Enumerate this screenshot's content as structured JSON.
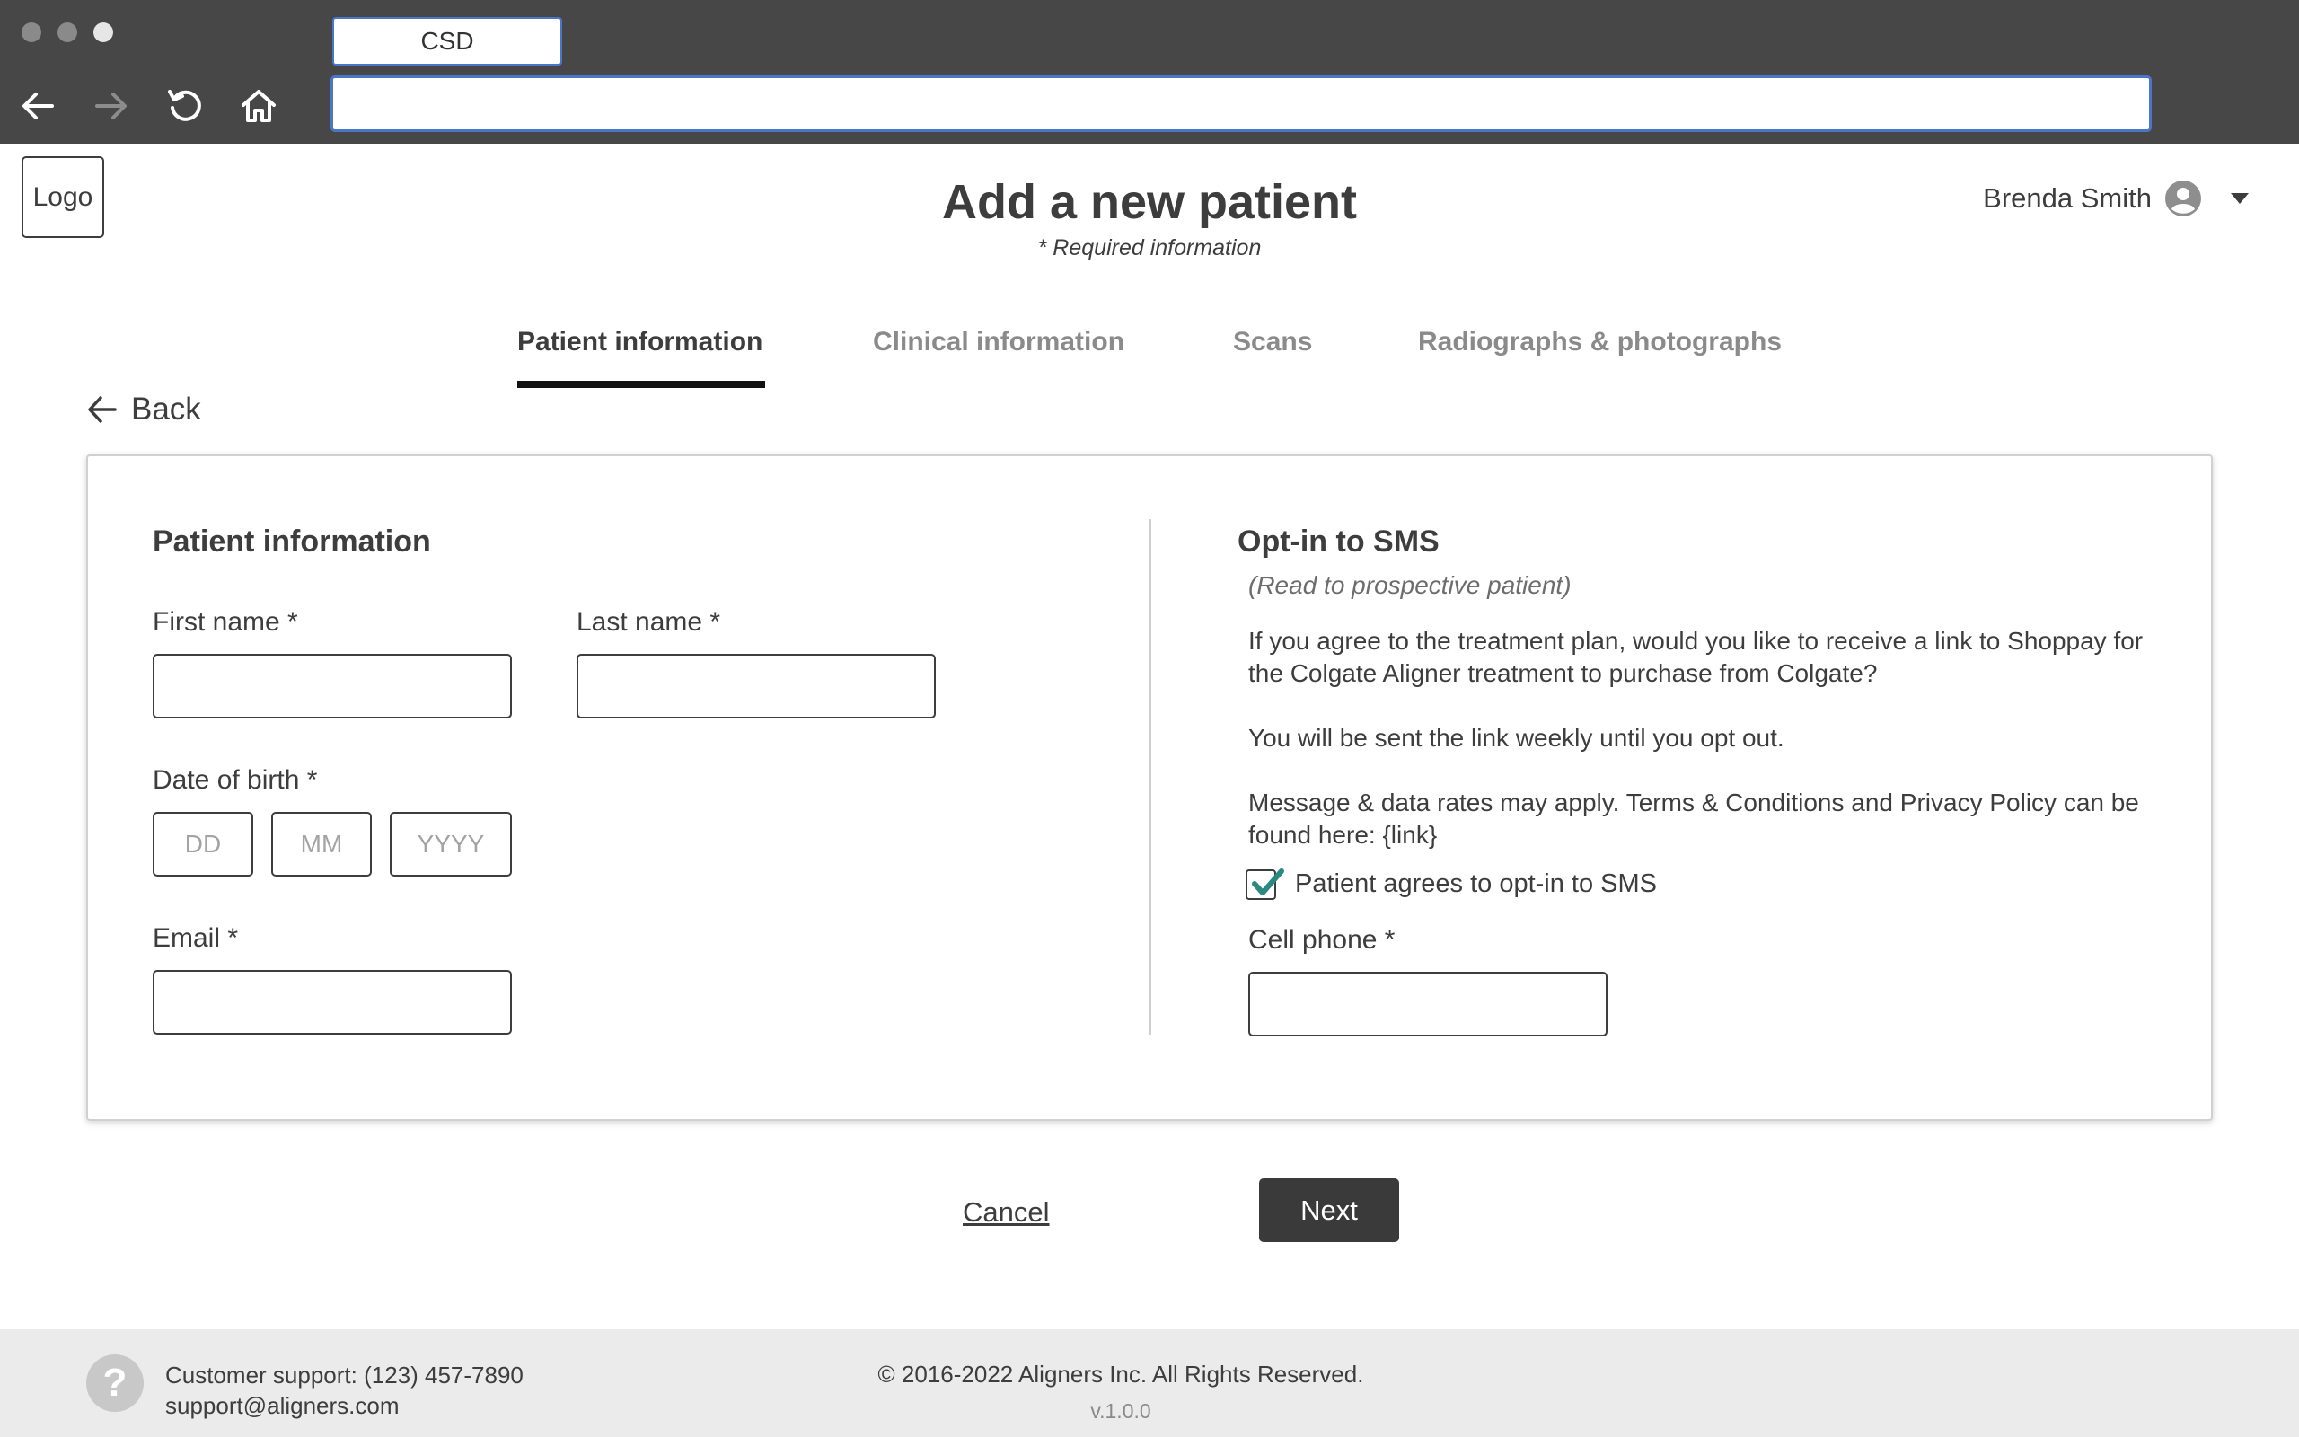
{
  "browser": {
    "tab_title": "CSD",
    "address_value": "",
    "icons": [
      "arrow-left-icon",
      "arrow-right-icon",
      "reload-icon",
      "home-icon"
    ]
  },
  "header": {
    "logo": "Logo",
    "title": "Add a new patient",
    "required_note": "* Required information",
    "user_name": "Brenda Smith"
  },
  "tabs": [
    {
      "label": "Patient information",
      "active": true
    },
    {
      "label": "Clinical information",
      "active": false
    },
    {
      "label": "Scans",
      "active": false
    },
    {
      "label": "Radiographs & photographs",
      "active": false
    }
  ],
  "back_label": "Back",
  "patient_info": {
    "title": "Patient information",
    "first_name_label": "First name *",
    "first_name_value": "",
    "last_name_label": "Last name *",
    "last_name_value": "",
    "dob_label": "Date of birth *",
    "dob_day_placeholder": "DD",
    "dob_month_placeholder": "MM",
    "dob_year_placeholder": "YYYY",
    "email_label": "Email *",
    "email_value": ""
  },
  "sms": {
    "title": "Opt-in to SMS",
    "subtitle": "(Read to prospective patient)",
    "para1": "If you agree to the treatment plan, would you like to receive a link to Shoppay for the Colgate Aligner treatment to purchase from Colgate?",
    "para2": "You will be sent the link weekly until you opt out.",
    "para3": "Message & data rates may apply. Terms & Conditions and Privacy Policy can be found here: {link}",
    "checkbox_label": "Patient agrees to opt-in to SMS",
    "checkbox_checked": true,
    "cell_label": "Cell phone *",
    "cell_value": ""
  },
  "actions": {
    "cancel": "Cancel",
    "next": "Next"
  },
  "footer": {
    "support_phone": "Customer support: (123) 457-7890",
    "support_email": "support@aligners.com",
    "copyright": "© 2016-2022 Aligners Inc. All Rights Reserved.",
    "version": "v.1.0.0"
  },
  "colors": {
    "chrome": "#474747",
    "accent_blue": "#4a76c9",
    "checkmark": "#2a8a80",
    "primary_button": "#3a3a3a"
  }
}
